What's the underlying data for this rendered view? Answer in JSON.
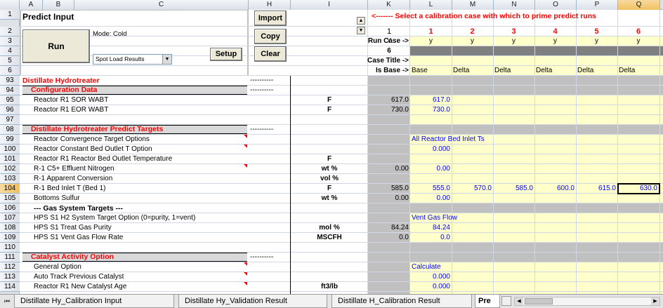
{
  "columns": [
    "A",
    "B",
    "C",
    "H",
    "I",
    "K",
    "L",
    "M",
    "N",
    "O",
    "P",
    "Q"
  ],
  "selected_column": "Q",
  "rows": [
    "1",
    "2",
    "3",
    "4",
    "5",
    "6",
    "93",
    "94",
    "95",
    "96",
    "97",
    "98",
    "99",
    "100",
    "101",
    "102",
    "103",
    "104",
    "105",
    "106",
    "107",
    "108",
    "109",
    "110",
    "111",
    "112",
    "113",
    "114"
  ],
  "selected_row": "104",
  "panel": {
    "title": "Predict Input",
    "run_label": "Run",
    "mode_text": "Mode: Cold",
    "dropdown_value": "Spot Load Results",
    "setup_label": "Setup",
    "import_label": "Import",
    "copy_label": "Copy",
    "clear_label": "Clear"
  },
  "header_area": {
    "instruction": "<------- Select a calibration case with which to prime predict runs",
    "case_numbers": [
      "1",
      "1",
      "2",
      "3",
      "4",
      "5",
      "6"
    ],
    "run_case_label": "Run Case ->",
    "run_case_values": [
      "Y",
      "y",
      "y",
      "y",
      "y",
      "y",
      "y"
    ],
    "count_value": "6",
    "case_title_label": "Case Title ->",
    "is_base_label": "Is Base ->",
    "is_base_values": [
      "Base",
      "Delta",
      "Delta",
      "Delta",
      "Delta",
      "Delta",
      "Delta"
    ]
  },
  "sections": {
    "distillate_hydrotreater": "Distillate Hydrotreater",
    "configuration_data": "Configuration Data",
    "predict_targets": "Distillate Hydrotreater Predict Targets",
    "gas_system_targets": "--- Gas System Targets ---",
    "catalyst_activity": "Catalyst Activity Option",
    "dashes": "----------"
  },
  "table_rows": [
    {
      "row": "95",
      "label": "Reactor R1 SOR WABT",
      "unit": "F",
      "k": "617.0",
      "l": "617.0"
    },
    {
      "row": "96",
      "label": "Reactor R1 EOR WABT",
      "unit": "F",
      "k": "730.0",
      "l": "730.0"
    },
    {
      "row": "99",
      "label": "Reactor Convergence Target Options",
      "unit": "",
      "k": "",
      "l": "All Reactor Bed Inlet Ts"
    },
    {
      "row": "100",
      "label": "Reactor Constant Bed Outlet T Option",
      "unit": "",
      "k": "",
      "l": "0.000"
    },
    {
      "row": "101",
      "label": "Reactor R1 Reactor Bed Outlet Temperature",
      "unit": "F",
      "k": "",
      "l": ""
    },
    {
      "row": "102",
      "label": "R-1 C5+ Effluent Nitrogen",
      "unit": "wt %",
      "k": "0.00",
      "l": "0.00"
    },
    {
      "row": "103",
      "label": "R-1 Apparent Conversion",
      "unit": "vol %",
      "k": "",
      "l": ""
    },
    {
      "row": "104",
      "label": "R-1 Bed Inlet T (Bed 1)",
      "unit": "F",
      "k": "585.0",
      "l": "555.0"
    },
    {
      "row": "105",
      "label": "Bottoms Sulfur",
      "unit": "wt %",
      "k": "0.00",
      "l": "0.00"
    },
    {
      "row": "107",
      "label": "HPS S1 H2 System Target Option (0=purity, 1=vent)",
      "unit": "",
      "k": "",
      "l": "Vent Gas Flow"
    },
    {
      "row": "108",
      "label": "HPS S1 Treat Gas Purity",
      "unit": "mol %",
      "k": "84.24",
      "l": "84.24"
    },
    {
      "row": "109",
      "label": "HPS S1 Vent Gas Flow Rate",
      "unit": "MSCFH",
      "k": "0.0",
      "l": "0.0"
    },
    {
      "row": "112",
      "label": "General Option",
      "unit": "",
      "k": "",
      "l": "Calculate"
    },
    {
      "row": "113",
      "label": "Auto Track Previous Catalyst",
      "unit": "",
      "k": "",
      "l": "0.000"
    },
    {
      "row": "114",
      "label": "Reactor R1 New Catalyst Age",
      "unit": "ft3/lb",
      "k": "",
      "l": "0.000"
    }
  ],
  "row104_extra": [
    "570.0",
    "585.0",
    "600.0",
    "615.0",
    "630.0"
  ],
  "tabs": [
    "Distillate Hy_Calibration Input",
    "Distillate Hy_Validation Result",
    "Distillate H_Calibration Result",
    "Pre"
  ],
  "active_tab": "Pre"
}
